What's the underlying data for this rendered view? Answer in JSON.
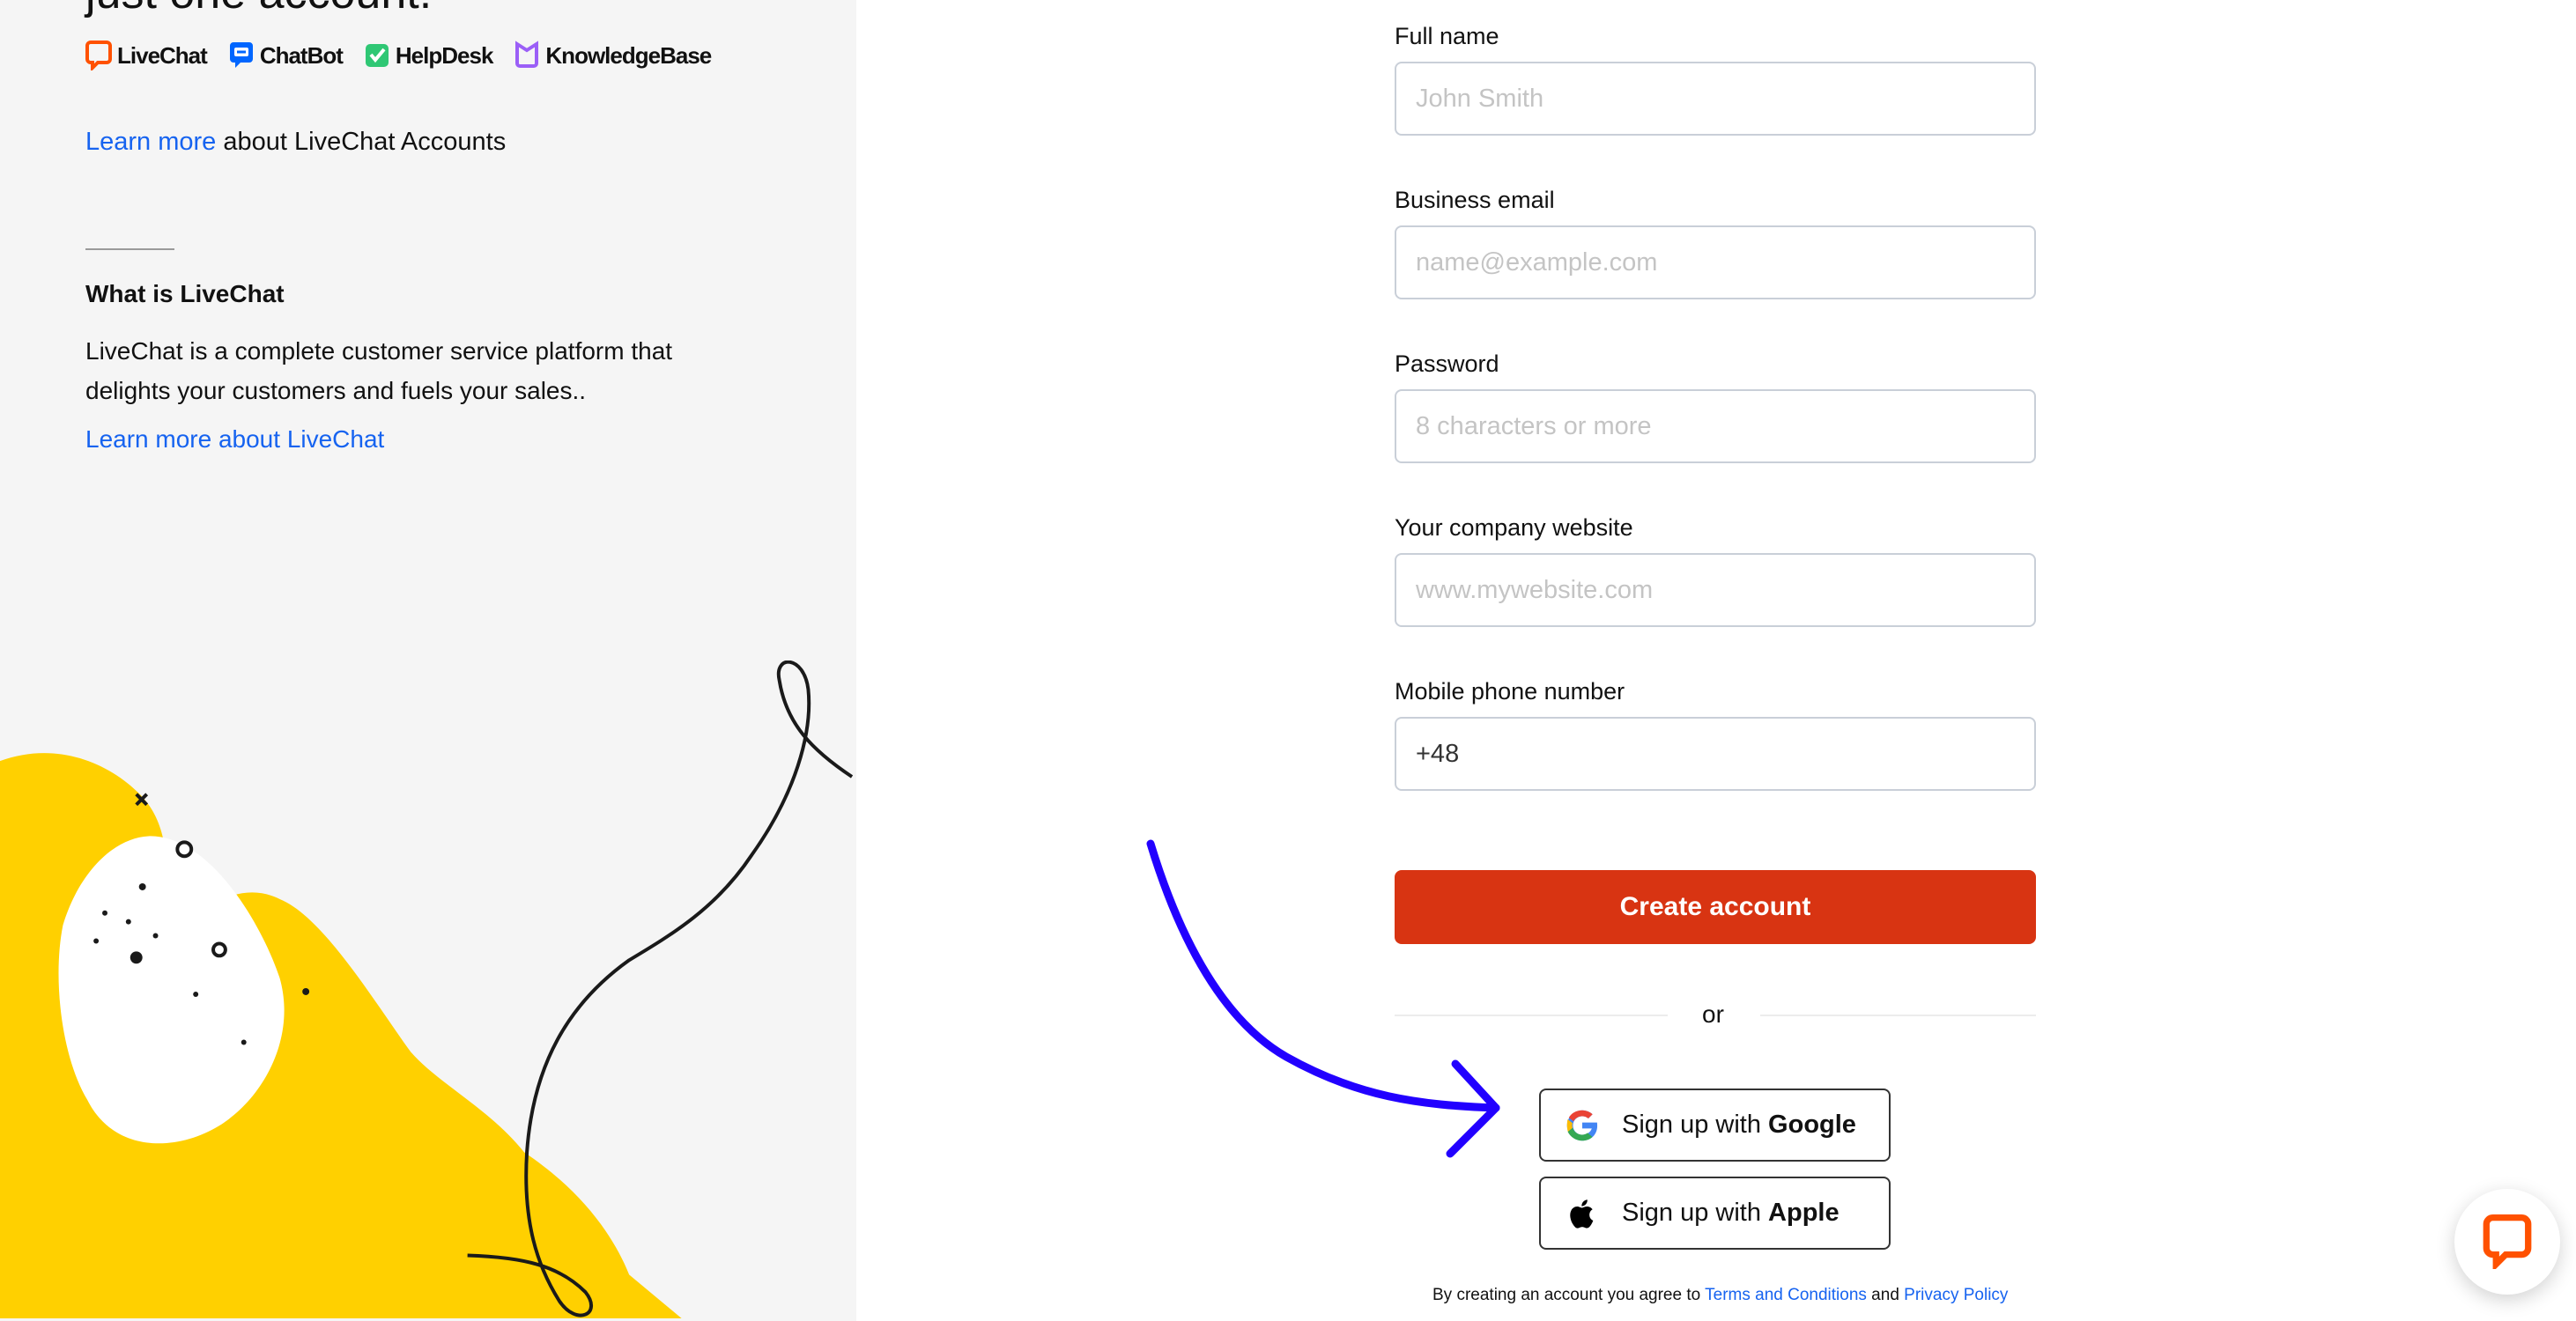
{
  "left": {
    "heading": "just one account.",
    "products": [
      {
        "name": "LiveChat",
        "icon": "livechat-logo-icon",
        "color": "#ff5100"
      },
      {
        "name": "ChatBot",
        "icon": "chatbot-logo-icon",
        "color": "#0066ff"
      },
      {
        "name": "HelpDesk",
        "icon": "helpdesk-logo-icon",
        "color": "#2fc774"
      },
      {
        "name": "KnowledgeBase",
        "icon": "knowledgebase-logo-icon",
        "color": "#9b5ff7"
      }
    ],
    "accounts_link": "Learn more",
    "accounts_text": " about LiveChat Accounts",
    "what_title": "What is LiveChat",
    "what_description": "LiveChat is a complete customer service platform that delights your customers and fuels your sales..",
    "what_link": "Learn more about LiveChat"
  },
  "form": {
    "fields": [
      {
        "label": "Full name",
        "placeholder": "John Smith",
        "value": ""
      },
      {
        "label": "Business email",
        "placeholder": "name@example.com",
        "value": ""
      },
      {
        "label": "Password",
        "placeholder": "8 characters or more",
        "value": ""
      },
      {
        "label": "Your company website",
        "placeholder": "www.mywebsite.com",
        "value": ""
      },
      {
        "label": "Mobile phone number",
        "placeholder": "",
        "value": "+48"
      }
    ],
    "create_button": "Create account",
    "or_text": "or",
    "google_prefix": "Sign up with ",
    "google_brand": "Google",
    "apple_prefix": "Sign up with ",
    "apple_brand": "Apple",
    "terms_prefix": "By creating an account you agree to ",
    "terms_link": "Terms and Conditions",
    "terms_and": " and ",
    "privacy_link": "Privacy Policy"
  },
  "colors": {
    "accent": "#d83412",
    "link": "#1663f0",
    "annotation_arrow": "#2200ff",
    "illustration_yellow": "#ffd000",
    "chat_widget_icon": "#ff5100"
  }
}
